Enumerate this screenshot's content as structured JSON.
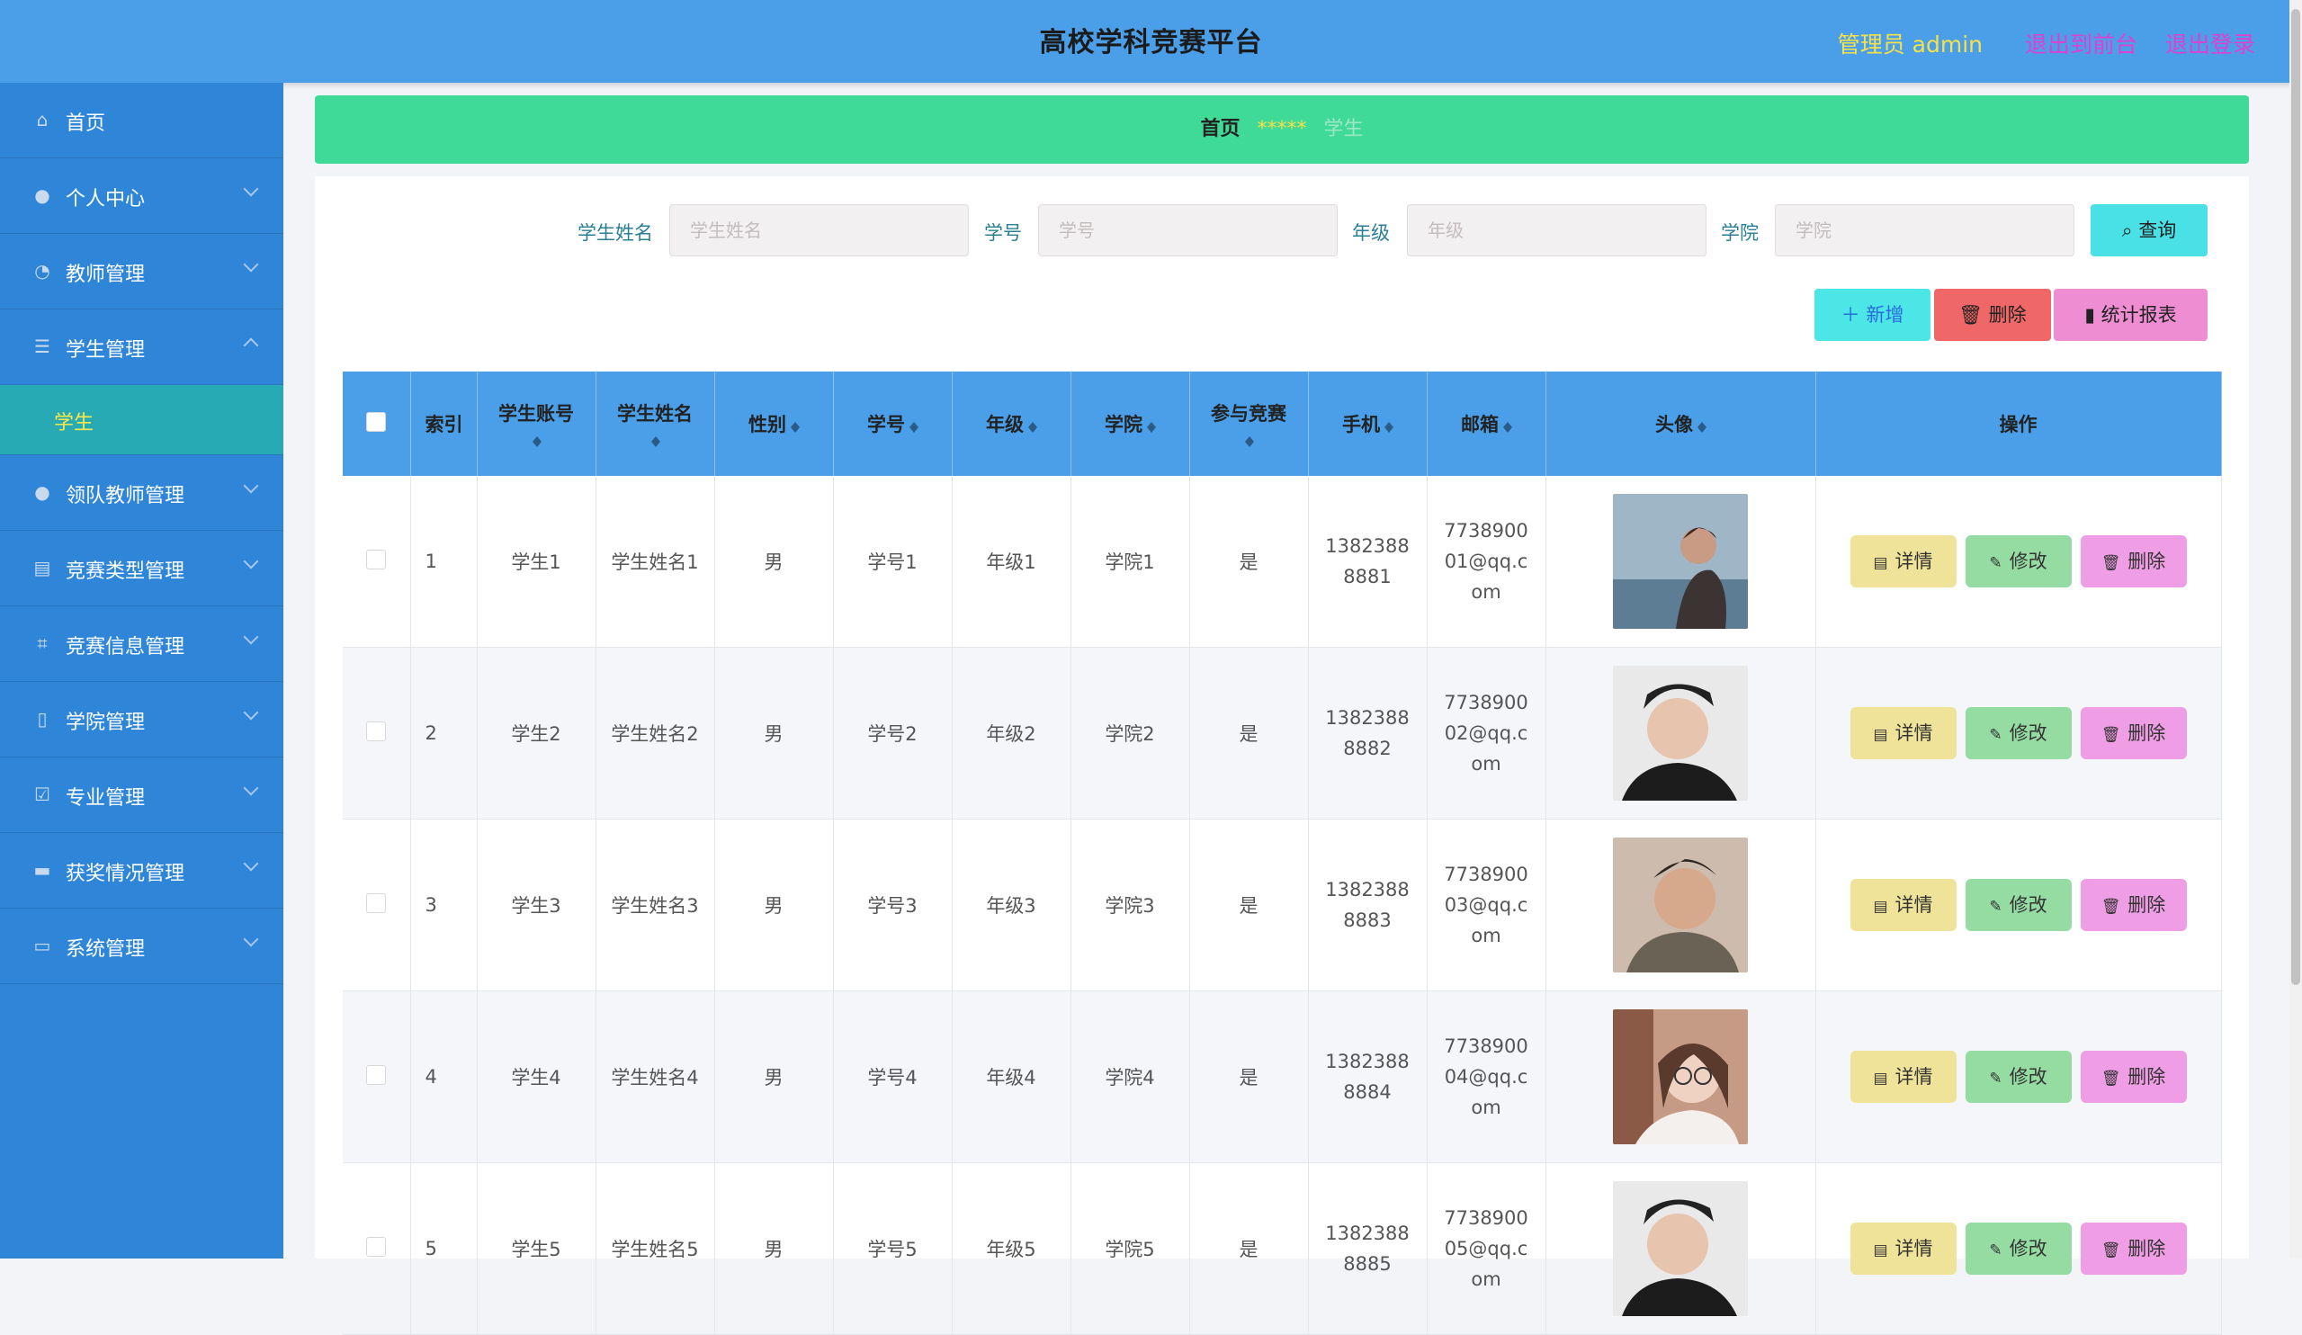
{
  "header": {
    "title": "高校学科竞赛平台",
    "admin_label": "管理员 admin",
    "front_link": "退出到前台",
    "logout_link": "退出登录"
  },
  "sidebar": {
    "items": [
      {
        "label": "首页",
        "icon": "home-icon"
      },
      {
        "label": "个人中心",
        "icon": "user-icon"
      },
      {
        "label": "教师管理",
        "icon": "dashboard-icon"
      },
      {
        "label": "学生管理",
        "icon": "list-icon"
      },
      {
        "label": "领队教师管理",
        "icon": "user-icon"
      },
      {
        "label": "竞赛类型管理",
        "icon": "clipboard-icon"
      },
      {
        "label": "竞赛信息管理",
        "icon": "crop-icon"
      },
      {
        "label": "学院管理",
        "icon": "mobile-icon"
      },
      {
        "label": "专业管理",
        "icon": "check-square-icon"
      },
      {
        "label": "获奖情况管理",
        "icon": "chat-icon"
      },
      {
        "label": "系统管理",
        "icon": "message-icon"
      }
    ],
    "sub_item": "学生"
  },
  "breadcrumb": {
    "home": "首页",
    "separator": "*****",
    "current": "学生"
  },
  "search": {
    "name_label": "学生姓名",
    "name_placeholder": "学生姓名",
    "xh_label": "学号",
    "xh_placeholder": "学号",
    "grade_label": "年级",
    "grade_placeholder": "年级",
    "college_label": "学院",
    "college_placeholder": "学院",
    "query_button": "查询"
  },
  "actions": {
    "add": "新增",
    "delete": "删除",
    "report": "统计报表"
  },
  "table": {
    "headers": [
      "索引",
      "学生账号",
      "学生姓名",
      "性别",
      "学号",
      "年级",
      "学院",
      "参与竞赛",
      "手机",
      "邮箱",
      "头像",
      "操作"
    ],
    "rows": [
      {
        "idx": "1",
        "account": "学生1",
        "name": "学生姓名1",
        "gender": "男",
        "xh": "学号1",
        "grade": "年级1",
        "college": "学院1",
        "joined": "是",
        "phone": "13823888881",
        "email": "773890001@qq.com"
      },
      {
        "idx": "2",
        "account": "学生2",
        "name": "学生姓名2",
        "gender": "男",
        "xh": "学号2",
        "grade": "年级2",
        "college": "学院2",
        "joined": "是",
        "phone": "13823888882",
        "email": "773890002@qq.com"
      },
      {
        "idx": "3",
        "account": "学生3",
        "name": "学生姓名3",
        "gender": "男",
        "xh": "学号3",
        "grade": "年级3",
        "college": "学院3",
        "joined": "是",
        "phone": "13823888883",
        "email": "773890003@qq.com"
      },
      {
        "idx": "4",
        "account": "学生4",
        "name": "学生姓名4",
        "gender": "男",
        "xh": "学号4",
        "grade": "年级4",
        "college": "学院4",
        "joined": "是",
        "phone": "13823888884",
        "email": "773890004@qq.com"
      },
      {
        "idx": "5",
        "account": "学生5",
        "name": "学生姓名5",
        "gender": "男",
        "xh": "学号5",
        "grade": "年级5",
        "college": "学院5",
        "joined": "是",
        "phone": "13823888885",
        "email": "773890005@qq.com"
      }
    ],
    "op_detail": "详情",
    "op_edit": "修改",
    "op_delete": "删除"
  },
  "colors": {
    "header": "#4a9fe8",
    "sidebar": "#2f86d8",
    "breadcrumb": "#3fda97",
    "accent_yellow": "#f5e14a"
  }
}
